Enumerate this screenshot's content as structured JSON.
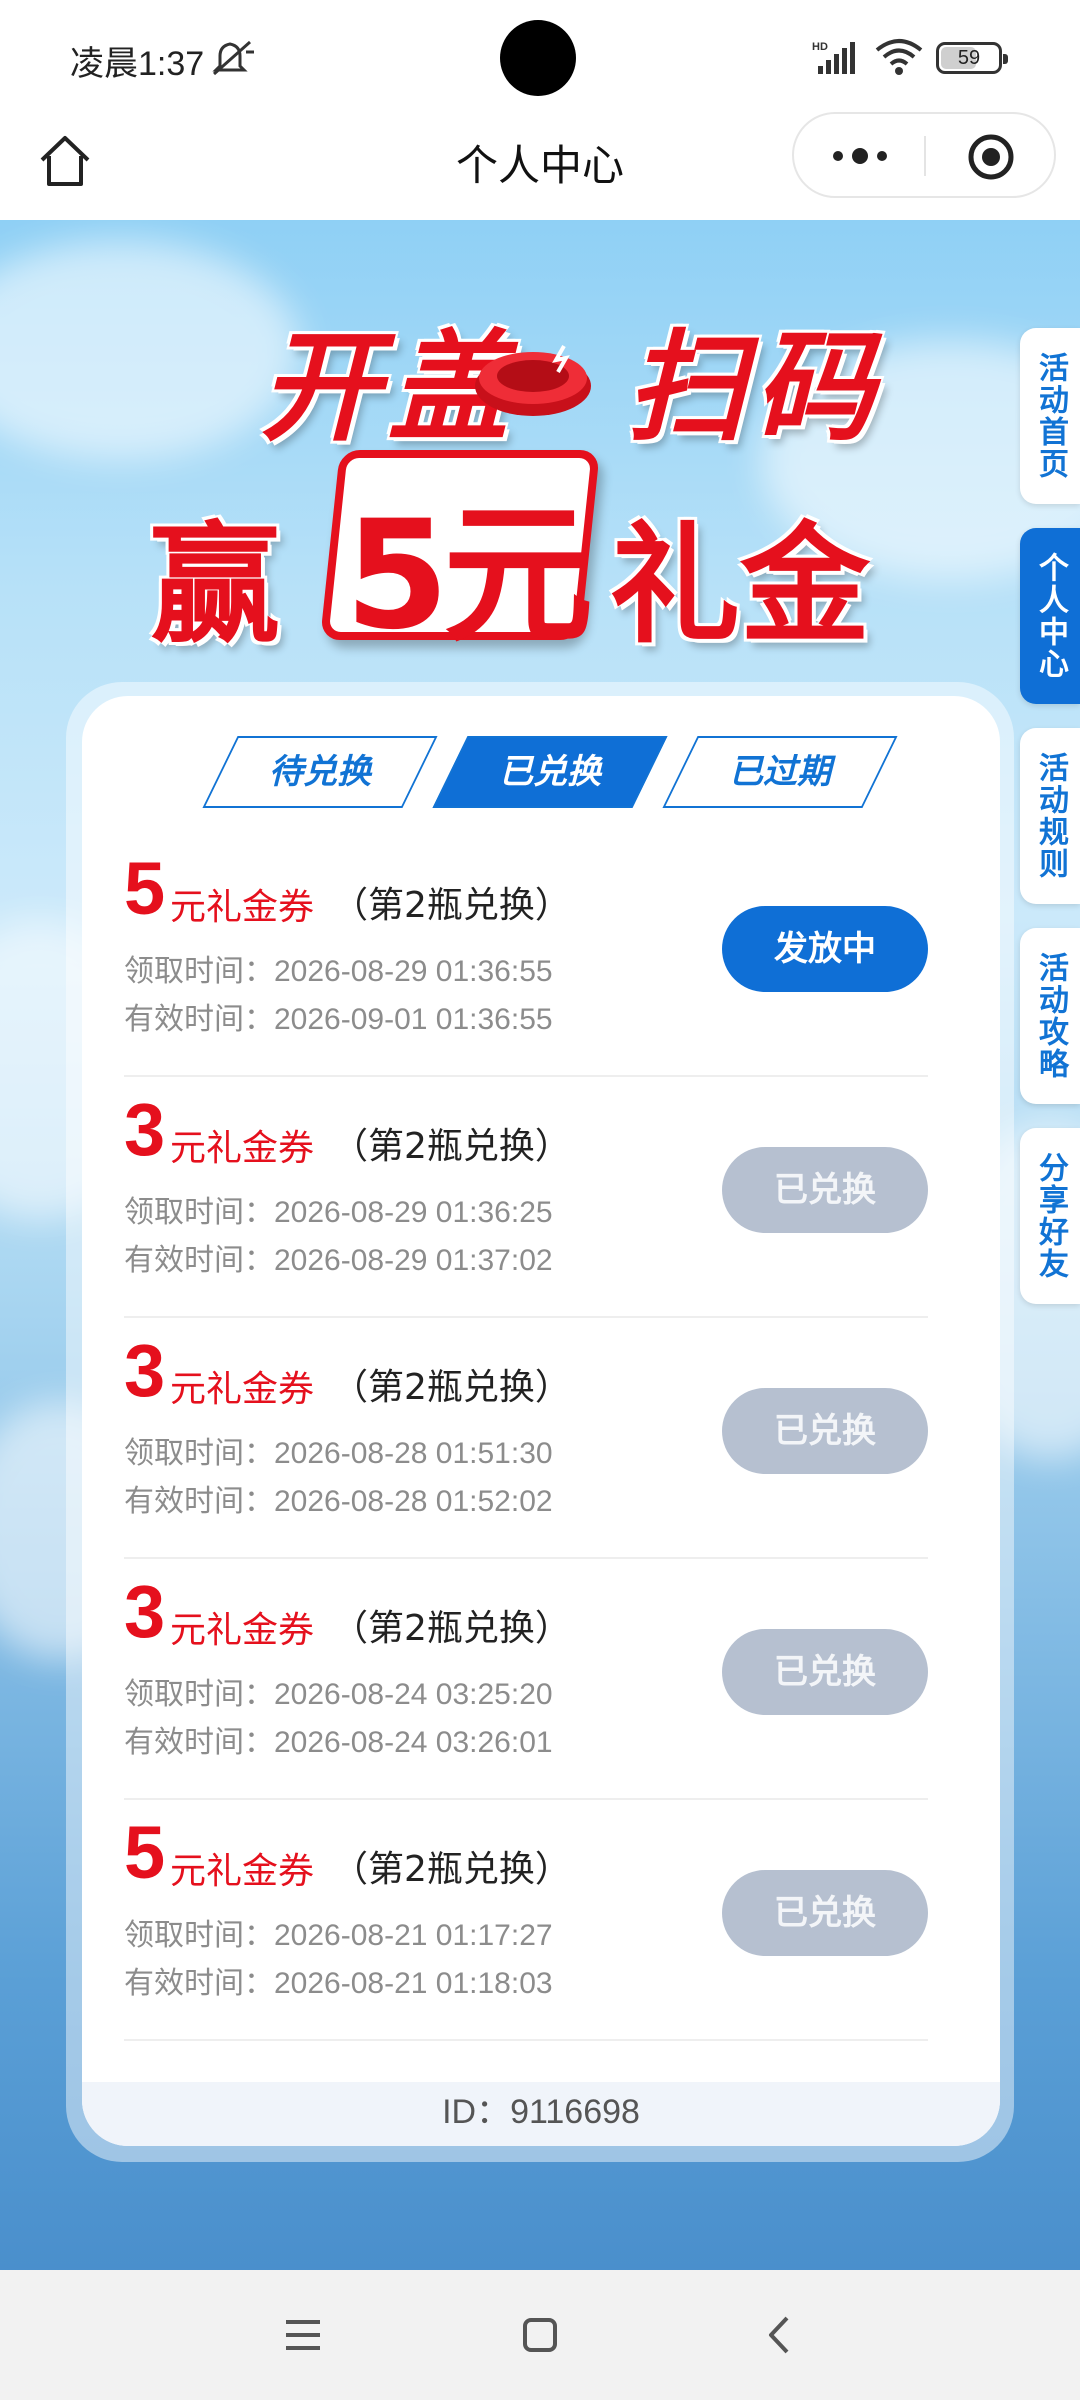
{
  "status_bar": {
    "time": "凌晨1:37",
    "signal_label": "HD",
    "battery": "59"
  },
  "nav": {
    "title": "个人中心"
  },
  "banner": {
    "line1_a": "开盖",
    "line1_b": "扫码",
    "line2_a": "赢",
    "amount": "5元",
    "line2_b": "礼金"
  },
  "side_tabs": [
    "活动首页",
    "个人中心",
    "活动规则",
    "活动攻略",
    "分享好友"
  ],
  "tabs": [
    {
      "label": "待兑换",
      "active": false
    },
    {
      "label": "已兑换",
      "active": true
    },
    {
      "label": "已过期",
      "active": false
    }
  ],
  "records_labels": {
    "receive": "领取时间：",
    "valid": "有效时间：",
    "unit": "元礼金券",
    "note": "（第2瓶兑换）"
  },
  "records": [
    {
      "amount": "5",
      "receive_time": "2026-08-29 01:36:55",
      "valid_time": "2026-09-01 01:36:55",
      "status": "发放中",
      "status_type": "primary"
    },
    {
      "amount": "3",
      "receive_time": "2026-08-29 01:36:25",
      "valid_time": "2026-08-29 01:37:02",
      "status": "已兑换",
      "status_type": "disabled"
    },
    {
      "amount": "3",
      "receive_time": "2026-08-28 01:51:30",
      "valid_time": "2026-08-28 01:52:02",
      "status": "已兑换",
      "status_type": "disabled"
    },
    {
      "amount": "3",
      "receive_time": "2026-08-24 03:25:20",
      "valid_time": "2026-08-24 03:26:01",
      "status": "已兑换",
      "status_type": "disabled"
    },
    {
      "amount": "5",
      "receive_time": "2026-08-21 01:17:27",
      "valid_time": "2026-08-21 01:18:03",
      "status": "已兑换",
      "status_type": "disabled"
    }
  ],
  "footer": {
    "id_text": "ID：9116698"
  },
  "colors": {
    "accent": "#0f6fd6",
    "red": "#e5101d",
    "disabled": "#b6c0d0"
  }
}
